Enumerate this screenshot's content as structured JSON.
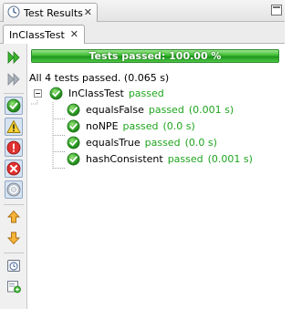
{
  "window": {
    "tab_title": "Test Results",
    "tab_close": "✕"
  },
  "subtab": {
    "title": "InClassTest",
    "close": "✕"
  },
  "toolbar": {
    "buttons": [
      {
        "icon": "rerun-all-icon"
      },
      {
        "icon": "rerun-failed-icon"
      },
      {
        "icon": "show-passed-icon"
      },
      {
        "icon": "show-warnings-icon"
      },
      {
        "icon": "show-failures-icon"
      },
      {
        "icon": "show-errors-icon"
      },
      {
        "icon": "show-skipped-icon"
      },
      {
        "icon": "previous-failure-icon"
      },
      {
        "icon": "next-failure-icon"
      },
      {
        "icon": "test-history-icon"
      },
      {
        "icon": "new-test-icon"
      }
    ]
  },
  "progress": {
    "text": "Tests passed: 100.00 %",
    "fraction": 1.0,
    "color": "#3dbb32"
  },
  "summary": "All 4 tests passed. (0.065 s)",
  "tree": {
    "suite": {
      "name": "InClassTest",
      "status": "passed"
    },
    "tests": [
      {
        "name": "equalsFalse",
        "status": "passed",
        "time": "(0.001 s)"
      },
      {
        "name": "noNPE",
        "status": "passed",
        "time": "(0.0 s)"
      },
      {
        "name": "equalsTrue",
        "status": "passed",
        "time": "(0.0 s)"
      },
      {
        "name": "hashConsistent",
        "status": "passed",
        "time": "(0.001 s)"
      }
    ]
  },
  "colors": {
    "pass": "#1ea51e",
    "icon_green": "#2fa02f"
  }
}
